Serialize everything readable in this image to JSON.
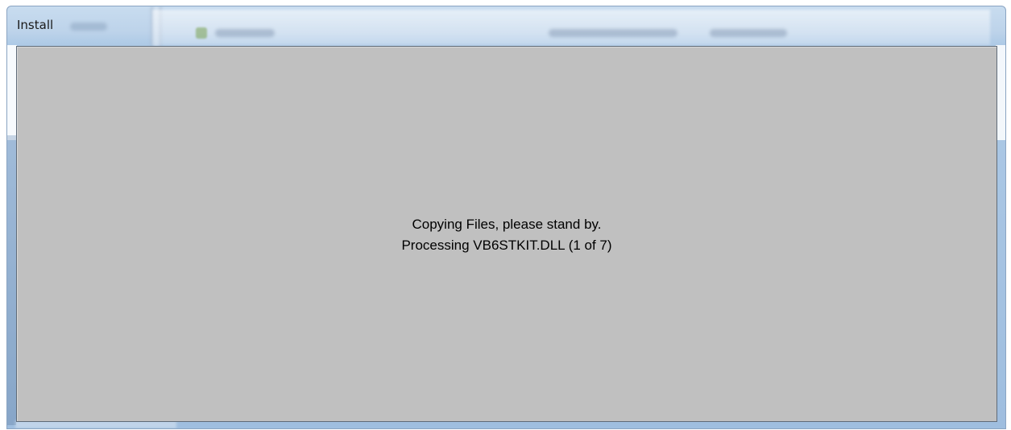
{
  "window": {
    "title": "Install"
  },
  "dialog": {
    "status_line_1": "Copying Files, please stand by.",
    "status_line_2": "Processing VB6STKIT.DLL (1 of 7)"
  },
  "colors": {
    "client_background": "#c0c0c0",
    "frame_glass": "#aecae6",
    "client_border": "#5f6b78",
    "text": "#000000"
  }
}
